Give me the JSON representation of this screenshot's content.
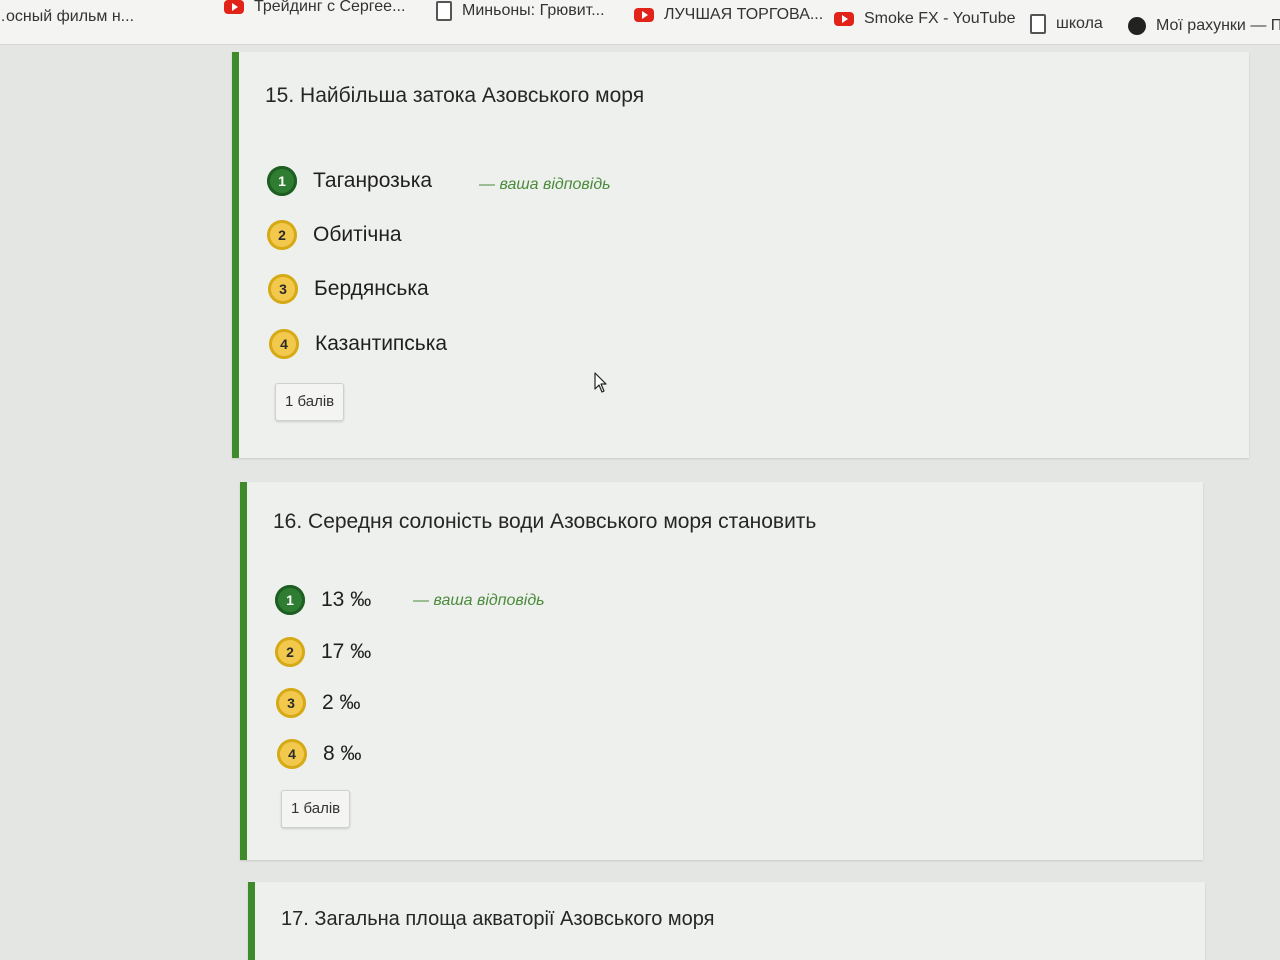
{
  "bookmarks": [
    {
      "label": "…осный фильм н...",
      "icon": "youtube-icon"
    },
    {
      "label": "Трейдинг с Сергее...",
      "icon": "youtube-icon"
    },
    {
      "label": "Миньоны: Грювит...",
      "icon": "page-icon"
    },
    {
      "label": "ЛУЧШАЯ ТОРГОВА...",
      "icon": "youtube-icon"
    },
    {
      "label": "Smoke FX - YouTube",
      "icon": "youtube-icon"
    },
    {
      "label": "школа",
      "icon": "page-icon"
    },
    {
      "label": "Мої рахунки — Пр",
      "icon": "account-icon"
    }
  ],
  "questions": [
    {
      "title": "15. Найбільша затока Азовського моря",
      "options": [
        {
          "num": "1",
          "text": "Таганрозька"
        },
        {
          "num": "2",
          "text": "Обитічна"
        },
        {
          "num": "3",
          "text": "Бердянська"
        },
        {
          "num": "4",
          "text": "Казантипська"
        }
      ],
      "your_answer_label": "— ваша відповідь",
      "points": "1 балів"
    },
    {
      "title": "16. Середня солоність води Азовського моря становить",
      "options": [
        {
          "num": "1",
          "text": "13 ‰"
        },
        {
          "num": "2",
          "text": "17 ‰"
        },
        {
          "num": "3",
          "text": "2 ‰"
        },
        {
          "num": "4",
          "text": "8 ‰"
        }
      ],
      "your_answer_label": "— ваша відповідь",
      "points": "1 балів"
    },
    {
      "title": "17. Загальна площа акваторії Азовського моря"
    }
  ],
  "colors": {
    "accent_green": "#3f8a2a",
    "correct_badge": "#2e7d32",
    "option_badge": "#f2c94c",
    "your_answer_text": "#4a8a3a"
  }
}
